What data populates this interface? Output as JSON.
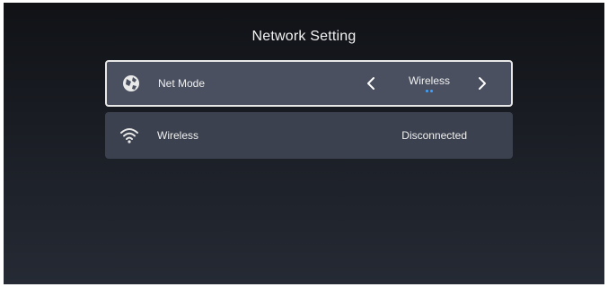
{
  "page": {
    "title": "Network Setting"
  },
  "rows": [
    {
      "label": "Net Mode",
      "value": "Wireless",
      "icon": "globe-icon",
      "selected": true,
      "options_indicator_count": 2
    },
    {
      "label": "Wireless",
      "value": "Disconnected",
      "icon": "wifi-icon",
      "selected": false
    }
  ],
  "colors": {
    "background_top": "#101216",
    "background_bottom": "#252a34",
    "row_selected": "#4a5060",
    "row_normal": "#3b414e",
    "selected_border": "#e8e8e8",
    "indicator_dot": "#3fa3ff",
    "text": "#f0f0f0"
  }
}
